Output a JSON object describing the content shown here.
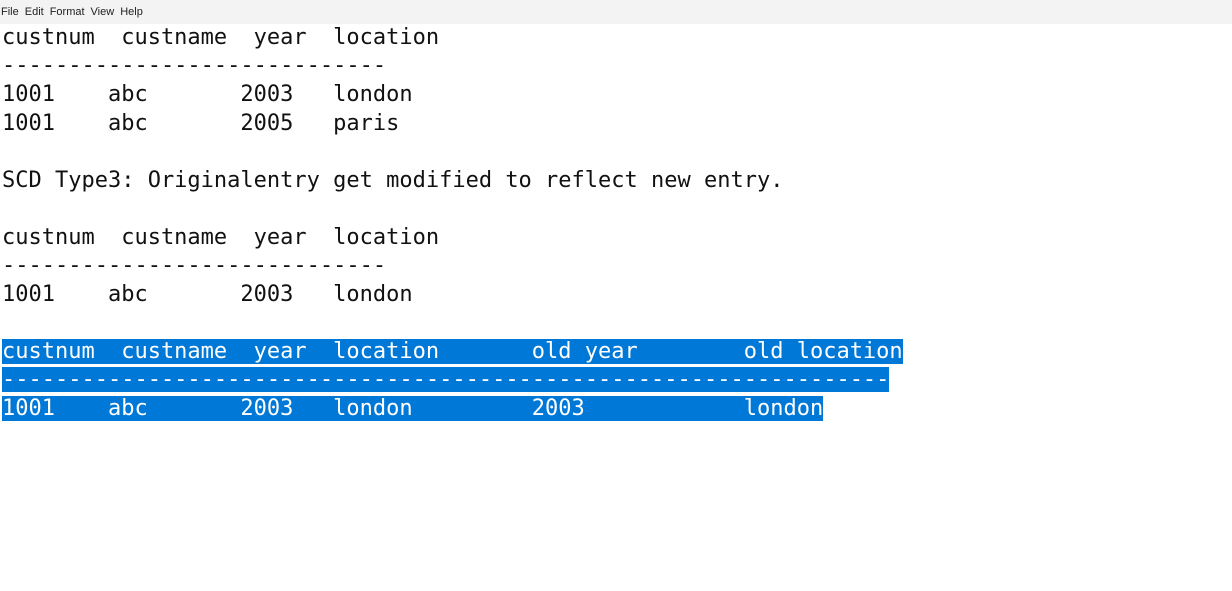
{
  "menu": [
    "File",
    "Edit",
    "Format",
    "View",
    "Help"
  ],
  "lines": [
    "custnum  custname  year  location",
    "-----------------------------",
    "1001    abc       2003   london",
    "1001    abc       2005   paris",
    "",
    "SCD Type3: Originalentry get modified to reflect new entry.",
    "",
    "custnum  custname  year  location",
    "-----------------------------",
    "1001    abc       2003   london",
    "",
    "custnum  custname  year  location       old year        old location",
    "-------------------------------------------------------------------",
    "1001    abc       2003   london         2003            london"
  ],
  "selection_color": "#0078d7"
}
